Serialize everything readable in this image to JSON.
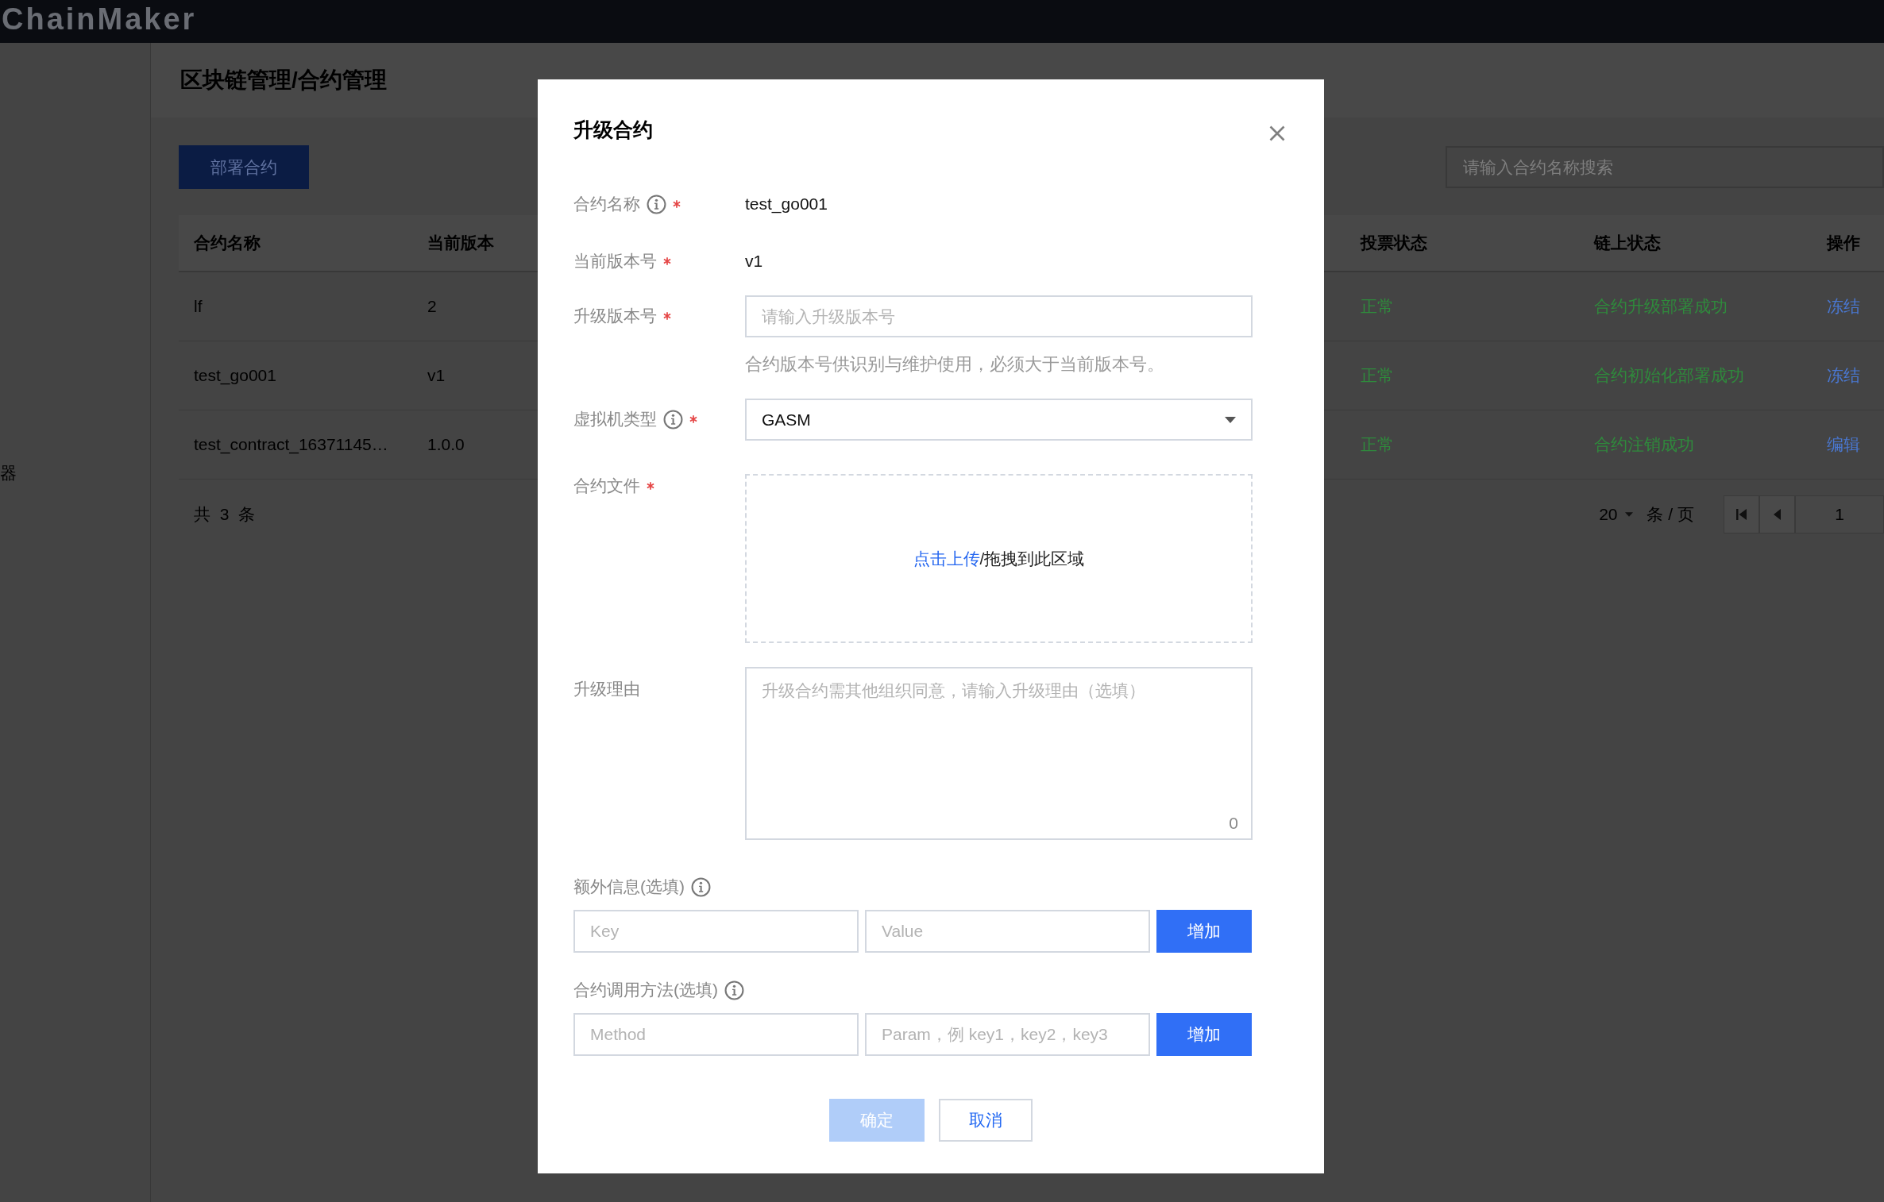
{
  "header": {
    "logo": "ChainMaker"
  },
  "sidebar": {
    "items": [
      {
        "label": "器"
      }
    ]
  },
  "page": {
    "title": "区块链管理/合约管理",
    "deploy_button": "部署合约",
    "search": {
      "placeholder": "请输入合约名称搜索"
    }
  },
  "table": {
    "columns": [
      "合约名称",
      "当前版本",
      "投票状态",
      "链上状态",
      "操作"
    ],
    "rows": [
      {
        "name": "lf",
        "version": "2",
        "vote_status": "正常",
        "chain_status": "合约升级部署成功",
        "actions": [
          "冻结"
        ]
      },
      {
        "name": "test_go001",
        "version": "v1",
        "vote_status": "正常",
        "chain_status": "合约初始化部署成功",
        "actions": [
          "冻结"
        ]
      },
      {
        "name": "test_contract_16371145…",
        "version": "1.0.0",
        "vote_status": "正常",
        "chain_status": "合约注销成功",
        "actions": [
          "编辑"
        ]
      }
    ]
  },
  "pagination": {
    "total": "共 3 条",
    "page_size": "20",
    "page_size_unit": "条 / 页",
    "page": "1"
  },
  "dialog": {
    "title": "升级合约",
    "fields": [
      {
        "kind": "static",
        "label": "合约名称",
        "help_icon": true,
        "required": true,
        "value": "test_go001"
      },
      {
        "kind": "static",
        "label": "当前版本号",
        "help_icon": false,
        "required": true,
        "value": "v1"
      },
      {
        "kind": "input",
        "label": "升级版本号",
        "help_icon": false,
        "required": true,
        "placeholder": "请输入升级版本号",
        "hint": "合约版本号供识别与维护使用，必须大于当前版本号。"
      },
      {
        "kind": "select",
        "label": "虚拟机类型",
        "help_icon": true,
        "required": true,
        "value": "GASM"
      },
      {
        "kind": "upload",
        "label": "合约文件",
        "help_icon": false,
        "required": true,
        "link": "点击上传",
        "text": "/拖拽到此区域"
      },
      {
        "kind": "textarea",
        "label": "升级理由",
        "help_icon": false,
        "required": false,
        "placeholder": "升级合约需其他组织同意，请输入升级理由（选填）",
        "counter": "0"
      }
    ],
    "groups": [
      {
        "label": "额外信息(选填)",
        "help_icon": true,
        "placeholders": [
          "Key",
          "Value"
        ],
        "button": "增加"
      },
      {
        "label": "合约调用方法(选填)",
        "help_icon": true,
        "placeholders": [
          "Method",
          "Param，例 key1，key2，key3"
        ],
        "button": "增加"
      }
    ],
    "buttons": [
      {
        "label": "确定",
        "kind": "primary",
        "disabled": true
      },
      {
        "label": "取消",
        "kind": "secondary",
        "disabled": false
      }
    ]
  }
}
